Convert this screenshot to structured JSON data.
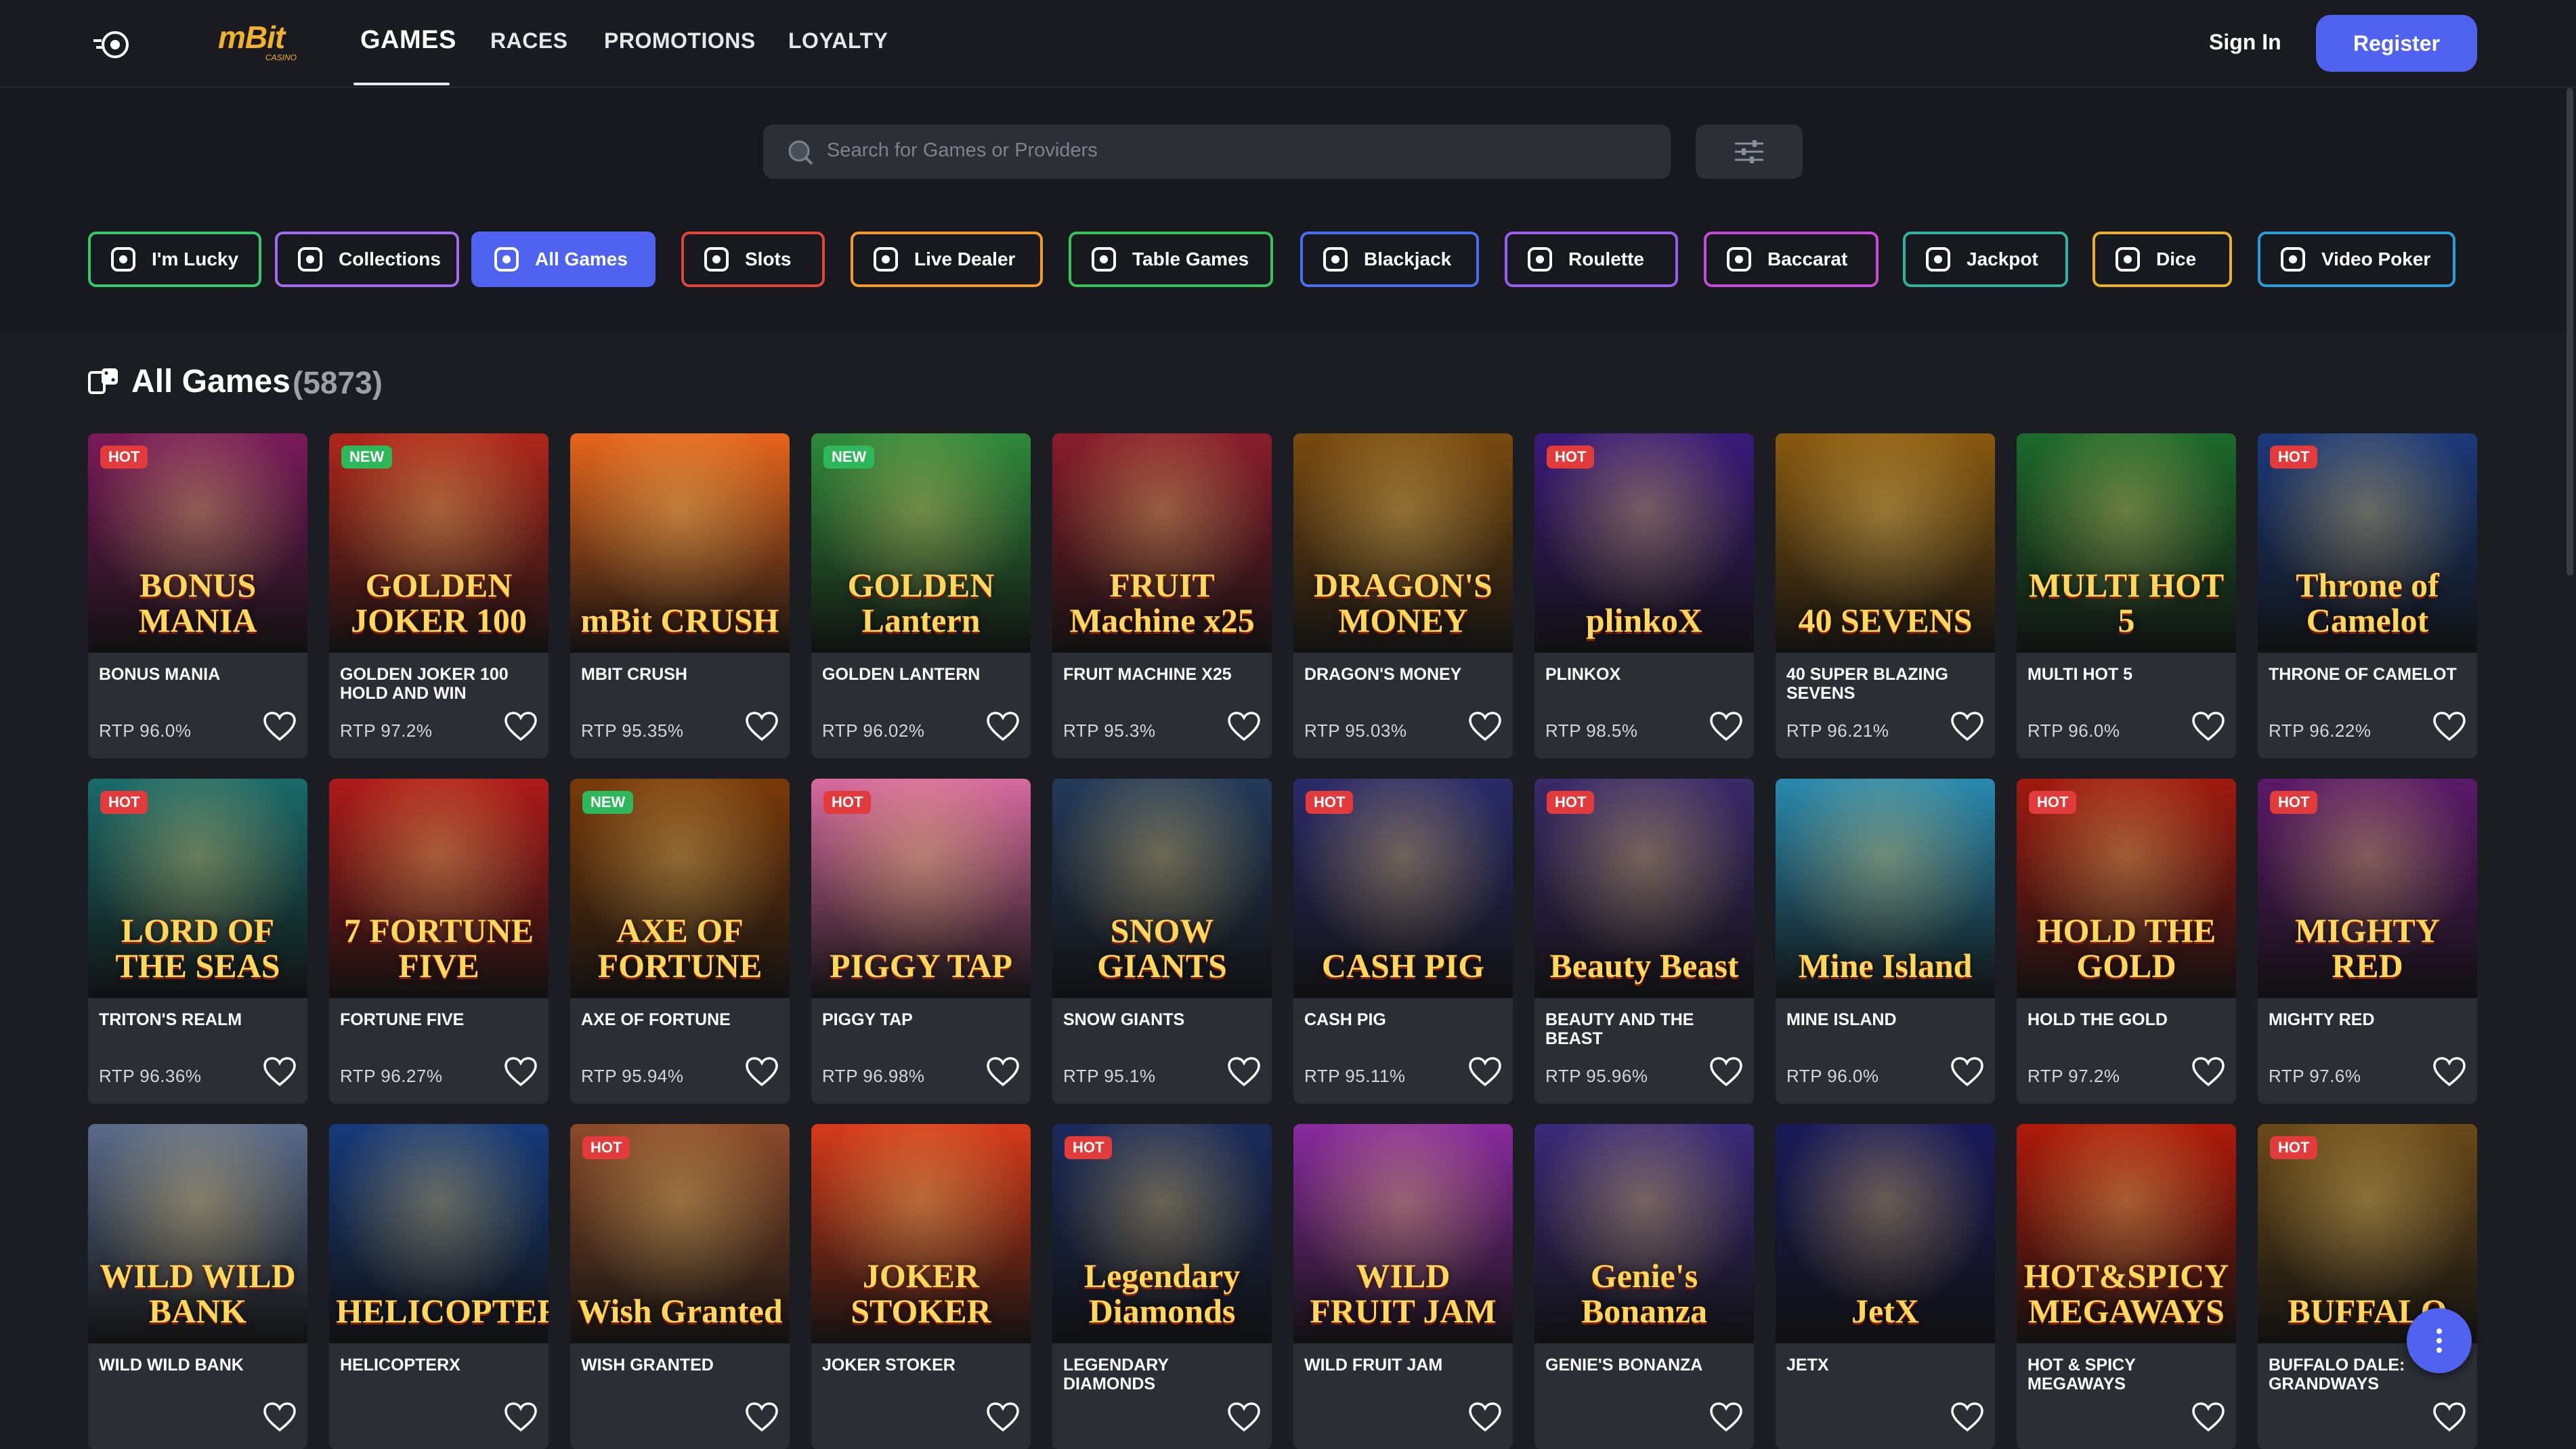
{
  "nav": {
    "brand": "mBit",
    "brand_sub": "CASINO",
    "items": [
      "GAMES",
      "RACES",
      "PROMOTIONS",
      "LOYALTY"
    ],
    "signin": "Sign In",
    "register": "Register"
  },
  "search": {
    "placeholder": "Search for Games or Providers"
  },
  "categories": [
    {
      "label": "I'm Lucky",
      "icon": "clover-icon",
      "color": "#36c96b"
    },
    {
      "label": "Collections",
      "icon": "collection-icon",
      "color": "#a26bf0"
    },
    {
      "label": "All Games",
      "icon": "dice-cards-icon",
      "color": "#4f63f0"
    },
    {
      "label": "Slots",
      "icon": "slot-machine-icon",
      "color": "#e0463c"
    },
    {
      "label": "Live Dealer",
      "icon": "dealer-icon",
      "color": "#f29a2e"
    },
    {
      "label": "Table Games",
      "icon": "table-icon",
      "color": "#38c25a"
    },
    {
      "label": "Blackjack",
      "icon": "cards-icon",
      "color": "#4a6ef0"
    },
    {
      "label": "Roulette",
      "icon": "roulette-icon",
      "color": "#9b5cf0"
    },
    {
      "label": "Baccarat",
      "icon": "baccarat-icon",
      "color": "#c64ad8"
    },
    {
      "label": "Jackpot",
      "icon": "cherry-icon",
      "color": "#2fb3a0"
    },
    {
      "label": "Dice",
      "icon": "dice-icon",
      "color": "#e8b02e"
    },
    {
      "label": "Video Poker",
      "icon": "poker-chip-icon",
      "color": "#2e9ad8"
    }
  ],
  "section": {
    "title": "All Games",
    "count": "(5873)"
  },
  "games": [
    {
      "name": "BONUS MANIA",
      "rtp": "RTP 96.0%",
      "badge": "HOT",
      "art": "BONUS MANIA",
      "bg": "#7a1a5a"
    },
    {
      "name": "GOLDEN JOKER 100 HOLD AND WIN",
      "rtp": "RTP 97.2%",
      "badge": "NEW",
      "art": "GOLDEN JOKER 100",
      "bg": "#b0261c"
    },
    {
      "name": "MBIT CRUSH",
      "rtp": "RTP 95.35%",
      "badge": "",
      "art": "mBit CRUSH",
      "bg": "#e8651c"
    },
    {
      "name": "GOLDEN LANTERN",
      "rtp": "RTP 96.02%",
      "badge": "NEW",
      "art": "GOLDEN Lantern",
      "bg": "#2f8a3c"
    },
    {
      "name": "FRUIT MACHINE X25",
      "rtp": "RTP 95.3%",
      "badge": "",
      "art": "FRUIT Machine x25",
      "bg": "#8a1c2c"
    },
    {
      "name": "DRAGON'S MONEY",
      "rtp": "RTP 95.03%",
      "badge": "",
      "art": "DRAGON'S MONEY",
      "bg": "#7a4a10"
    },
    {
      "name": "PLINKOX",
      "rtp": "RTP 98.5%",
      "badge": "HOT",
      "art": "plinkoX",
      "bg": "#3a1a7a"
    },
    {
      "name": "40 SUPER BLAZING SEVENS",
      "rtp": "RTP 96.21%",
      "badge": "",
      "art": "40 SEVENS",
      "bg": "#8a5a10"
    },
    {
      "name": "MULTI HOT 5",
      "rtp": "RTP 96.0%",
      "badge": "",
      "art": "MULTI HOT 5",
      "bg": "#1c6a2c"
    },
    {
      "name": "THRONE OF CAMELOT",
      "rtp": "RTP 96.22%",
      "badge": "HOT",
      "art": "Throne of Camelot",
      "bg": "#1c3a7a"
    },
    {
      "name": "TRITON'S REALM",
      "rtp": "RTP 96.36%",
      "badge": "HOT",
      "art": "LORD OF THE SEAS",
      "bg": "#1a6a6a"
    },
    {
      "name": "FORTUNE FIVE",
      "rtp": "RTP 96.27%",
      "badge": "",
      "art": "7 FORTUNE FIVE",
      "bg": "#b01a1a"
    },
    {
      "name": "AXE OF FORTUNE",
      "rtp": "RTP 95.94%",
      "badge": "NEW",
      "art": "AXE OF FORTUNE",
      "bg": "#7a3a0a"
    },
    {
      "name": "PIGGY TAP",
      "rtp": "RTP 96.98%",
      "badge": "HOT",
      "art": "PIGGY TAP",
      "bg": "#d86aa0"
    },
    {
      "name": "SNOW GIANTS",
      "rtp": "RTP 95.1%",
      "badge": "",
      "art": "SNOW GIANTS",
      "bg": "#243a5a"
    },
    {
      "name": "CASH PIG",
      "rtp": "RTP 95.11%",
      "badge": "HOT",
      "art": "CASH PIG",
      "bg": "#2a2a6a"
    },
    {
      "name": "BEAUTY AND THE BEAST",
      "rtp": "RTP 95.96%",
      "badge": "HOT",
      "art": "Beauty Beast",
      "bg": "#3a2a6a"
    },
    {
      "name": "MINE ISLAND",
      "rtp": "RTP 96.0%",
      "badge": "",
      "art": "Mine Island",
      "bg": "#2a8ab0"
    },
    {
      "name": "HOLD THE GOLD",
      "rtp": "RTP 97.2%",
      "badge": "HOT",
      "art": "HOLD THE GOLD",
      "bg": "#a01a10"
    },
    {
      "name": "MIGHTY RED",
      "rtp": "RTP 97.6%",
      "badge": "HOT",
      "art": "MIGHTY RED",
      "bg": "#5a1a6a"
    },
    {
      "name": "WILD WILD BANK",
      "rtp": "",
      "badge": "",
      "art": "WILD WILD BANK",
      "bg": "#5a6a8a"
    },
    {
      "name": "HELICOPTERX",
      "rtp": "",
      "badge": "",
      "art": "HELICOPTERX",
      "bg": "#163a7a"
    },
    {
      "name": "WISH GRANTED",
      "rtp": "",
      "badge": "HOT",
      "art": "Wish Granted",
      "bg": "#8a4a2a"
    },
    {
      "name": "JOKER STOKER",
      "rtp": "",
      "badge": "",
      "art": "JOKER STOKER",
      "bg": "#d83a1a"
    },
    {
      "name": "LEGENDARY DIAMONDS",
      "rtp": "",
      "badge": "HOT",
      "art": "Legendary Diamonds",
      "bg": "#1a2a5a"
    },
    {
      "name": "WILD FRUIT JAM",
      "rtp": "",
      "badge": "",
      "art": "WILD FRUIT JAM",
      "bg": "#8a2aa0"
    },
    {
      "name": "GENIE'S BONANZA",
      "rtp": "",
      "badge": "",
      "art": "Genie's Bonanza",
      "bg": "#3a2a7a"
    },
    {
      "name": "JETX",
      "rtp": "",
      "badge": "",
      "art": "JetX",
      "bg": "#1a1a5a"
    },
    {
      "name": "HOT & SPICY MEGAWAYS",
      "rtp": "",
      "badge": "",
      "art": "HOT&SPICY MEGAWAYS",
      "bg": "#b01a0a"
    },
    {
      "name": "BUFFALO DALE: GRANDWAYS",
      "rtp": "",
      "badge": "HOT",
      "art": "BUFFALO",
      "bg": "#6a4a1a"
    }
  ],
  "colors": {
    "accent": "#4f63f0",
    "hot": "#e23b3b",
    "new": "#2fb85b",
    "brand": "#f2b22e"
  }
}
